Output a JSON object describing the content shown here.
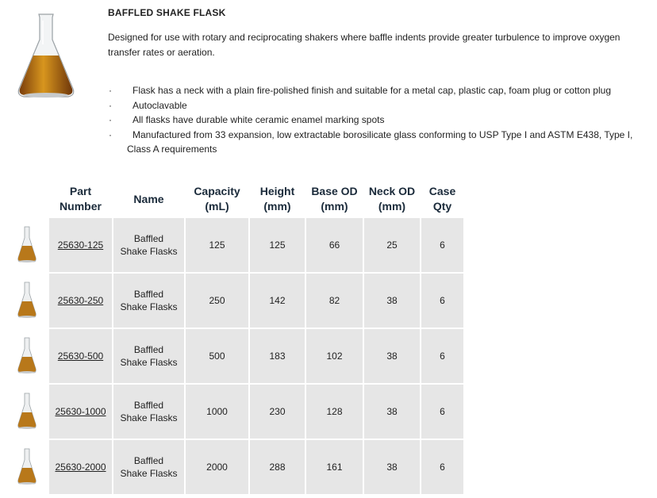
{
  "product": {
    "title": "BAFFLED SHAKE FLASK",
    "description": "Designed for use with rotary and reciprocating shakers where baffle indents provide greater turbulence to improve oxygen transfer rates or aeration.",
    "bullet_char": "·",
    "features": [
      "Flask has a neck with a plain fire-polished finish and suitable for a metal cap, plastic cap, foam plug or cotton plug",
      "Autoclavable",
      "All flasks have durable white ceramic enamel marking spots",
      "Manufactured from 33 expansion, low extractable borosilicate glass conforming to USP Type I and ASTM E438, Type I, Class A requirements"
    ]
  },
  "table": {
    "headers": {
      "part_number": [
        "Part",
        "Number"
      ],
      "name": [
        "Name"
      ],
      "capacity": [
        "Capacity",
        "(mL)"
      ],
      "height": [
        "Height",
        "(mm)"
      ],
      "base_od": [
        "Base OD",
        "(mm)"
      ],
      "neck_od": [
        "Neck OD",
        "(mm)"
      ],
      "case_qty": [
        "Case",
        "Qty"
      ]
    },
    "rows": [
      {
        "part_number": "25630-125",
        "name": [
          "Baffled",
          "Shake Flasks"
        ],
        "capacity": "125",
        "height": "125",
        "base_od": "66",
        "neck_od": "25",
        "case_qty": "6"
      },
      {
        "part_number": "25630-250",
        "name": [
          "Baffled",
          "Shake Flasks"
        ],
        "capacity": "250",
        "height": "142",
        "base_od": "82",
        "neck_od": "38",
        "case_qty": "6"
      },
      {
        "part_number": "25630-500",
        "name": [
          "Baffled",
          "Shake Flasks"
        ],
        "capacity": "500",
        "height": "183",
        "base_od": "102",
        "neck_od": "38",
        "case_qty": "6"
      },
      {
        "part_number": "25630-1000",
        "name": [
          "Baffled",
          "Shake Flasks"
        ],
        "capacity": "1000",
        "height": "230",
        "base_od": "128",
        "neck_od": "38",
        "case_qty": "6"
      },
      {
        "part_number": "25630-2000",
        "name": [
          "Baffled",
          "Shake Flasks"
        ],
        "capacity": "2000",
        "height": "288",
        "base_od": "161",
        "neck_od": "38",
        "case_qty": "6"
      }
    ]
  },
  "colors": {
    "cell_background": "#e6e6e6",
    "header_text": "#1a2a3a",
    "liquid": "#b8781a"
  },
  "icons": {
    "product_image": "flask-icon",
    "row_image": "flask-icon"
  }
}
